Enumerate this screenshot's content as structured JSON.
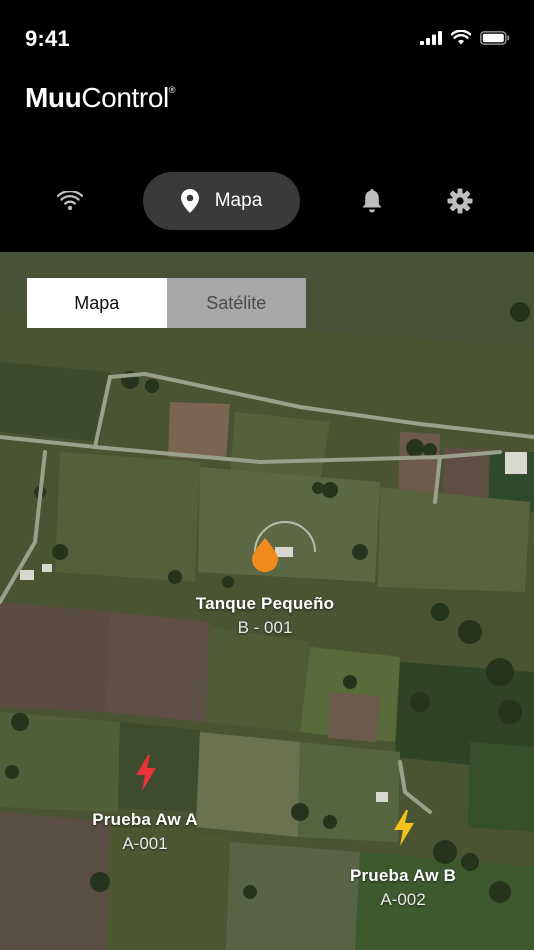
{
  "status_bar": {
    "time": "9:41"
  },
  "brand": {
    "bold": "Muu",
    "regular": "Control",
    "reg_mark": "®"
  },
  "nav": {
    "items": [
      {
        "id": "connection",
        "icon": "wifi-icon"
      },
      {
        "id": "map",
        "icon": "map-pin-icon",
        "label": "Mapa",
        "active": true
      },
      {
        "id": "alerts",
        "icon": "bell-icon"
      },
      {
        "id": "settings",
        "icon": "gear-icon"
      }
    ]
  },
  "map_toggle": {
    "options": [
      {
        "label": "Mapa",
        "selected": true
      },
      {
        "label": "Satélite",
        "selected": false
      }
    ]
  },
  "markers": [
    {
      "name": "Tanque Pequeño",
      "code": "B - 001",
      "icon": "water-drop-icon",
      "color": "#f08a1c"
    },
    {
      "name": "Prueba Aw A",
      "code": "A-001",
      "icon": "lightning-icon",
      "color": "#e8333a"
    },
    {
      "name": "Prueba Aw B",
      "code": "A-002",
      "icon": "lightning-icon",
      "color": "#f4c21a"
    }
  ],
  "colors": {
    "header_bg": "#000000",
    "nav_active_bg": "#3a3a3a"
  }
}
